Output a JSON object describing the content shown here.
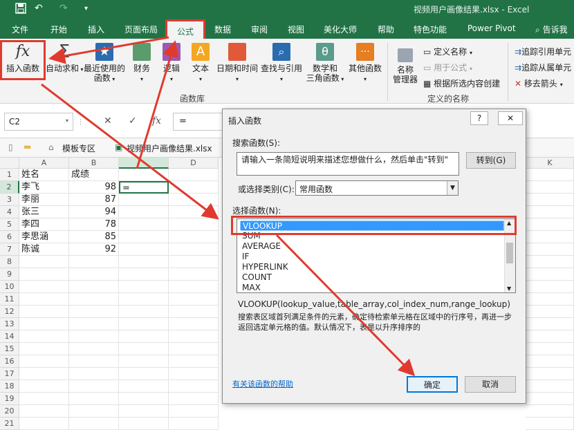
{
  "title_bar": {
    "title": "视频用户画像结果.xlsx - Excel",
    "quick_access": [
      "save-icon",
      "undo-icon",
      "redo-icon"
    ]
  },
  "ribbon_tabs": [
    "文件",
    "开始",
    "插入",
    "页面布局",
    "公式",
    "数据",
    "审阅",
    "视图",
    "美化大师",
    "帮助",
    "特色功能",
    "Power Pivot",
    "告诉我"
  ],
  "active_tab": "公式",
  "ribbon": {
    "insert_function": "插入函数",
    "autosum": "自动求和",
    "recent_line1": "最近使用的",
    "recent_line2": "函数",
    "financial": "财务",
    "logical": "逻辑",
    "text": "文本",
    "datetime": "日期和时间",
    "lookup": "查找与引用",
    "math_line1": "数学和",
    "math_line2": "三角函数",
    "more": "其他函数",
    "function_library_label": "函数库",
    "name_manager_line1": "名称",
    "name_manager_line2": "管理器",
    "define_name": "定义名称",
    "use_in_formula": "用于公式",
    "create_from_selection": "根据所选内容创建",
    "defined_names_label": "定义的名称",
    "trace_precedents": "追踪引用单元",
    "trace_dependents": "追踪从属单元",
    "remove_arrows": "移去箭头"
  },
  "formula_bar": {
    "name_box": "C2",
    "cancel": "✕",
    "enter": "✓",
    "fx": "fx",
    "value": "="
  },
  "sheet_tabs": {
    "template": "模板专区",
    "file": "视频用户画像结果.xlsx"
  },
  "columns": [
    "A",
    "B",
    "C",
    "D",
    "K"
  ],
  "rows": [
    "1",
    "2",
    "3",
    "4",
    "5",
    "6",
    "7",
    "8",
    "9",
    "10",
    "11",
    "12",
    "13",
    "14",
    "15",
    "16",
    "17",
    "18",
    "19",
    "20",
    "21"
  ],
  "table": [
    {
      "a": "姓名",
      "b": "成绩"
    },
    {
      "a": "李飞",
      "b": "98"
    },
    {
      "a": "李丽",
      "b": "87"
    },
    {
      "a": "张三",
      "b": "94"
    },
    {
      "a": "李四",
      "b": "78"
    },
    {
      "a": "李思涵",
      "b": "85"
    },
    {
      "a": "陈诚",
      "b": "92"
    }
  ],
  "active_cell_value": "=",
  "dialog": {
    "title": "插入函数",
    "help_btn": "?",
    "close_btn": "✕",
    "search_label": "搜索函数(S):",
    "search_placeholder": "请输入一条简短说明来描述您想做什么，然后单击\"转到\"",
    "go_button": "转到(G)",
    "category_label": "或选择类别(C):",
    "category_value": "常用函数",
    "select_label": "选择函数(N):",
    "functions": [
      "VLOOKUP",
      "SUM",
      "AVERAGE",
      "IF",
      "HYPERLINK",
      "COUNT",
      "MAX"
    ],
    "selected_function": "VLOOKUP",
    "signature": "VLOOKUP(lookup_value,table_array,col_index_num,range_lookup)",
    "description": "搜索表区域首列满足条件的元素，确定待检索单元格在区域中的行序号，再进一步返回选定单元格的值。默认情况下，表是以升序排序的",
    "help_link": "有关该函数的帮助",
    "ok_button": "确定",
    "cancel_button": "取消"
  },
  "colors": {
    "excel_green": "#217346",
    "annotation_red": "#e03a2f",
    "selection_blue": "#3399ff"
  }
}
